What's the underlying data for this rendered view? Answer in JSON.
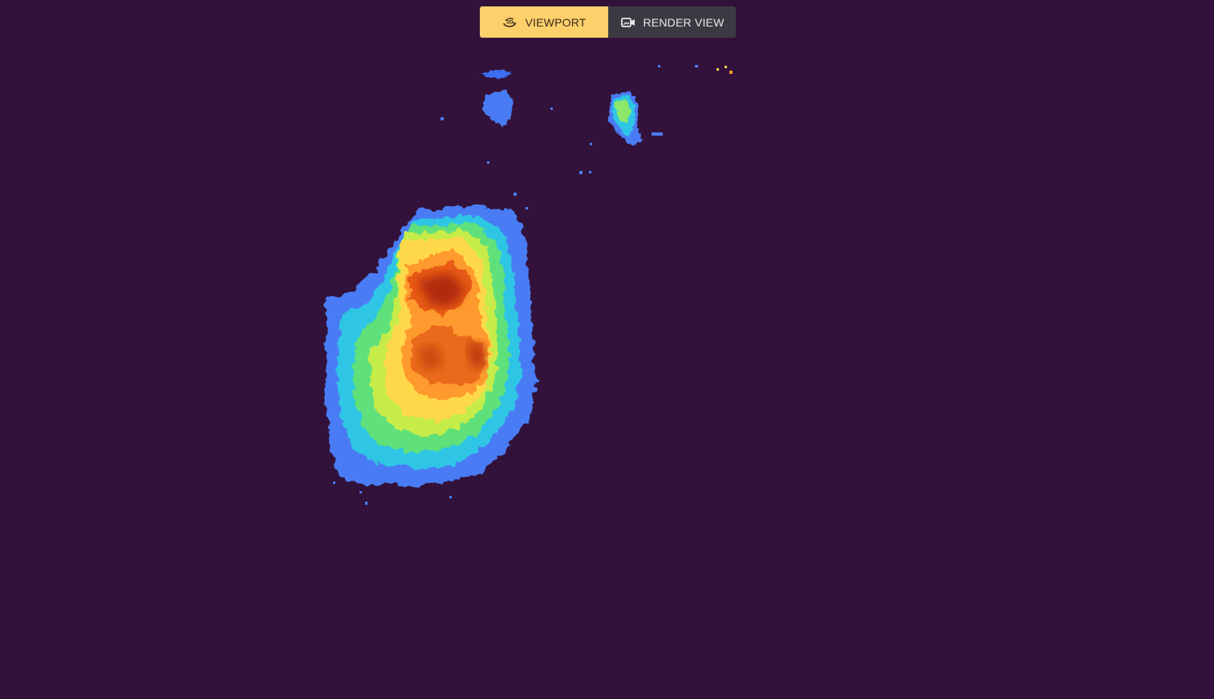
{
  "toolbar": {
    "viewport_label": "VIEWPORT",
    "render_label": "RENDER VIEW",
    "active": "viewport",
    "viewport_icon": "3d-rotate-icon",
    "render_icon": "camera-render-icon"
  },
  "colors": {
    "background": "#32123a",
    "active_button": "#fdd06c",
    "inactive_button": "#3b3a42"
  },
  "viewer": {
    "colormap": "turbo",
    "content": "depth heatmap render"
  }
}
